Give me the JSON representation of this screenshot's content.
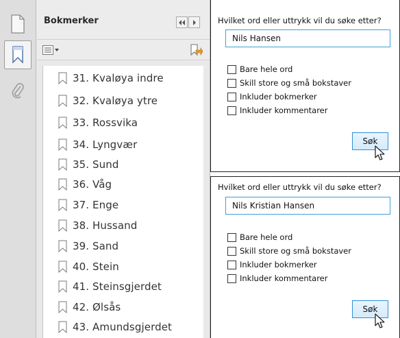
{
  "bookmarks_panel": {
    "title": "Bokmerker",
    "items": [
      {
        "label": "31. Kvaløya indre"
      },
      {
        "label": "32. Kvaløya ytre"
      },
      {
        "label": "33. Rossvika"
      },
      {
        "label": "34. Lyngvær"
      },
      {
        "label": "35. Sund"
      },
      {
        "label": "36. Våg"
      },
      {
        "label": "37. Enge"
      },
      {
        "label": "38. Hussand"
      },
      {
        "label": "39. Sand"
      },
      {
        "label": "40. Stein"
      },
      {
        "label": "41. Steinsgjerdet"
      },
      {
        "label": "42. Ølsås"
      },
      {
        "label": "43. Amundsgjerdet"
      }
    ]
  },
  "search_dialogs": [
    {
      "question": "Hvilket ord eller uttrykk vil du søke etter?",
      "input_value": "Nils Hansen",
      "options": [
        {
          "label": "Bare hele ord",
          "checked": false
        },
        {
          "label": "Skill store og små bokstaver",
          "checked": false
        },
        {
          "label": "Inkluder bokmerker",
          "checked": false
        },
        {
          "label": "Inkluder kommentarer",
          "checked": false
        }
      ],
      "search_button": "Søk"
    },
    {
      "question": "Hvilket ord eller uttrykk vil du søke etter?",
      "input_value": "Nils Kristian Hansen",
      "options": [
        {
          "label": "Bare hele ord",
          "checked": false
        },
        {
          "label": "Skill store og små bokstaver",
          "checked": false
        },
        {
          "label": "Inkluder bokmerker",
          "checked": false
        },
        {
          "label": "Inkluder kommentarer",
          "checked": false
        }
      ],
      "search_button": "Søk"
    }
  ],
  "colors": {
    "input_border": "#3aa0d8",
    "button_border": "#2b8fd8",
    "panel_bg": "#e9e9e9"
  },
  "icons": [
    "pages-icon",
    "bookmark-icon",
    "paperclip-icon",
    "options-menu-icon",
    "new-bookmark-icon",
    "collapse-icon",
    "expand-icon",
    "mouse-pointer-icon"
  ]
}
